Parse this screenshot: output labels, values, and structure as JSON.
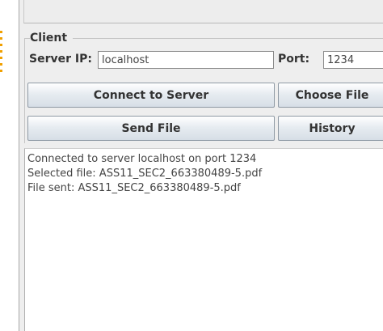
{
  "client": {
    "legend": "Client",
    "server_ip_label": "Server IP:",
    "server_ip_value": "localhost",
    "port_label": "Port:",
    "port_value": "1234"
  },
  "buttons": {
    "connect": "Connect to Server",
    "choose_file": "Choose File",
    "send_file": "Send File",
    "history": "History"
  },
  "log": {
    "lines": [
      "Connected to server localhost on port 1234",
      "Selected file: ASS11_SEC2_663380489-5.pdf",
      "File sent: ASS11_SEC2_663380489-5.pdf"
    ]
  }
}
